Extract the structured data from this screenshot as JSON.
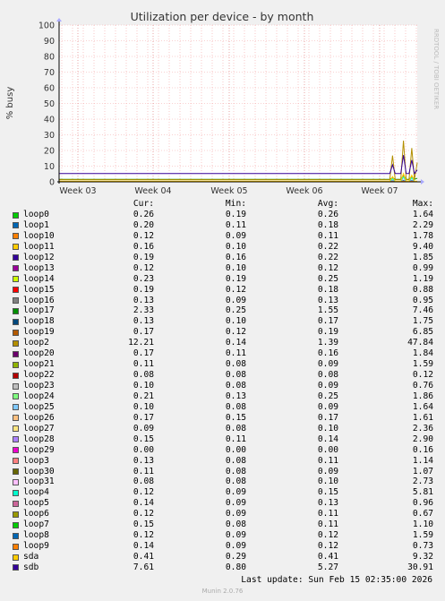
{
  "chart_data": {
    "type": "line",
    "title": "Utilization per device - by month",
    "ylabel": "% busy",
    "ylim": [
      0,
      100
    ],
    "yticks": [
      0,
      10,
      20,
      30,
      40,
      50,
      60,
      70,
      80,
      90,
      100
    ],
    "xlabels": [
      "Week 03",
      "Week 04",
      "Week 05",
      "Week 06",
      "Week 07"
    ],
    "grid": true,
    "side_label": "RRDTOOL / TOBI OETIKER",
    "legend_headers": {
      "cur": "Cur:",
      "min": "Min:",
      "avg": "Avg:",
      "max": "Max:"
    },
    "series": [
      {
        "name": "loop0",
        "color": "#00cc00",
        "cur": "0.26",
        "min": "0.19",
        "avg": "0.26",
        "max": "1.64"
      },
      {
        "name": "loop1",
        "color": "#0066b3",
        "cur": "0.20",
        "min": "0.11",
        "avg": "0.18",
        "max": "2.29"
      },
      {
        "name": "loop10",
        "color": "#ff8000",
        "cur": "0.12",
        "min": "0.09",
        "avg": "0.11",
        "max": "1.78"
      },
      {
        "name": "loop11",
        "color": "#ffcc00",
        "cur": "0.16",
        "min": "0.10",
        "avg": "0.22",
        "max": "9.40"
      },
      {
        "name": "loop12",
        "color": "#330099",
        "cur": "0.19",
        "min": "0.16",
        "avg": "0.22",
        "max": "1.85"
      },
      {
        "name": "loop13",
        "color": "#990099",
        "cur": "0.12",
        "min": "0.10",
        "avg": "0.12",
        "max": "0.99"
      },
      {
        "name": "loop14",
        "color": "#ccff00",
        "cur": "0.23",
        "min": "0.19",
        "avg": "0.25",
        "max": "1.19"
      },
      {
        "name": "loop15",
        "color": "#ff0000",
        "cur": "0.19",
        "min": "0.12",
        "avg": "0.18",
        "max": "0.88"
      },
      {
        "name": "loop16",
        "color": "#808080",
        "cur": "0.13",
        "min": "0.09",
        "avg": "0.13",
        "max": "0.95"
      },
      {
        "name": "loop17",
        "color": "#008f00",
        "cur": "2.33",
        "min": "0.25",
        "avg": "1.55",
        "max": "7.46"
      },
      {
        "name": "loop18",
        "color": "#00487d",
        "cur": "0.13",
        "min": "0.10",
        "avg": "0.17",
        "max": "1.75"
      },
      {
        "name": "loop19",
        "color": "#b35a00",
        "cur": "0.17",
        "min": "0.12",
        "avg": "0.19",
        "max": "6.85"
      },
      {
        "name": "loop2",
        "color": "#b38f00",
        "cur": "12.21",
        "min": "0.14",
        "avg": "1.39",
        "max": "47.84"
      },
      {
        "name": "loop20",
        "color": "#6b006b",
        "cur": "0.17",
        "min": "0.11",
        "avg": "0.16",
        "max": "1.84"
      },
      {
        "name": "loop21",
        "color": "#8fb300",
        "cur": "0.11",
        "min": "0.08",
        "avg": "0.09",
        "max": "1.59"
      },
      {
        "name": "loop22",
        "color": "#b30000",
        "cur": "0.08",
        "min": "0.08",
        "avg": "0.08",
        "max": "0.12"
      },
      {
        "name": "loop23",
        "color": "#bebebe",
        "cur": "0.10",
        "min": "0.08",
        "avg": "0.09",
        "max": "0.76"
      },
      {
        "name": "loop24",
        "color": "#80ff80",
        "cur": "0.21",
        "min": "0.13",
        "avg": "0.25",
        "max": "1.86"
      },
      {
        "name": "loop25",
        "color": "#80c9ff",
        "cur": "0.10",
        "min": "0.08",
        "avg": "0.09",
        "max": "1.64"
      },
      {
        "name": "loop26",
        "color": "#ffc080",
        "cur": "0.17",
        "min": "0.15",
        "avg": "0.17",
        "max": "1.61"
      },
      {
        "name": "loop27",
        "color": "#ffe680",
        "cur": "0.09",
        "min": "0.08",
        "avg": "0.10",
        "max": "2.36"
      },
      {
        "name": "loop28",
        "color": "#aa80ff",
        "cur": "0.15",
        "min": "0.11",
        "avg": "0.14",
        "max": "2.90"
      },
      {
        "name": "loop29",
        "color": "#ee00cc",
        "cur": "0.00",
        "min": "0.00",
        "avg": "0.00",
        "max": "0.16"
      },
      {
        "name": "loop3",
        "color": "#ff8080",
        "cur": "0.13",
        "min": "0.08",
        "avg": "0.11",
        "max": "1.14"
      },
      {
        "name": "loop30",
        "color": "#666600",
        "cur": "0.11",
        "min": "0.08",
        "avg": "0.09",
        "max": "1.07"
      },
      {
        "name": "loop31",
        "color": "#ffbfff",
        "cur": "0.08",
        "min": "0.08",
        "avg": "0.10",
        "max": "2.73"
      },
      {
        "name": "loop4",
        "color": "#00ffcc",
        "cur": "0.12",
        "min": "0.09",
        "avg": "0.15",
        "max": "5.81"
      },
      {
        "name": "loop5",
        "color": "#cc6699",
        "cur": "0.14",
        "min": "0.09",
        "avg": "0.13",
        "max": "0.96"
      },
      {
        "name": "loop6",
        "color": "#999900",
        "cur": "0.12",
        "min": "0.09",
        "avg": "0.11",
        "max": "0.67"
      },
      {
        "name": "loop7",
        "color": "#00cc00",
        "cur": "0.15",
        "min": "0.08",
        "avg": "0.11",
        "max": "1.10"
      },
      {
        "name": "loop8",
        "color": "#0066b3",
        "cur": "0.12",
        "min": "0.09",
        "avg": "0.12",
        "max": "1.59"
      },
      {
        "name": "loop9",
        "color": "#ff8000",
        "cur": "0.14",
        "min": "0.09",
        "avg": "0.12",
        "max": "0.73"
      },
      {
        "name": "sda",
        "color": "#ffcc00",
        "cur": "0.41",
        "min": "0.29",
        "avg": "0.41",
        "max": "9.32"
      },
      {
        "name": "sdb",
        "color": "#330099",
        "cur": "7.61",
        "min": "0.80",
        "avg": "5.27",
        "max": "30.91"
      }
    ],
    "last_update": "Last update: Sun Feb 15 02:35:00 2026",
    "generator": "Munin 2.0.76"
  }
}
